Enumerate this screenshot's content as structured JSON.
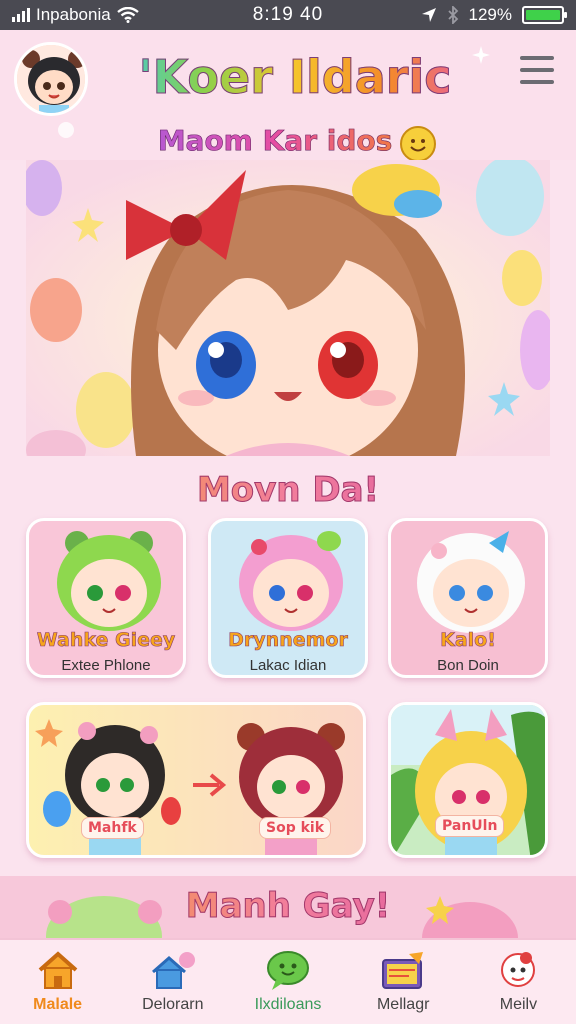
{
  "status_bar": {
    "carrier": "Inpabonia",
    "time": "8:19 40",
    "battery": "129%",
    "battery_level": 1.0
  },
  "header": {
    "title": "'Koer Ildaric",
    "subtitle": "Maom Kar idos"
  },
  "section1": {
    "title": "Movn Da!"
  },
  "cards": [
    {
      "name": "Wahke Gieey",
      "sub": "Extee Phlone"
    },
    {
      "name": "Drynnemor",
      "sub": "Lakac Idian"
    },
    {
      "name": "Kalo!",
      "sub": "Bon Doin"
    },
    {
      "tag_left": "Mahfk",
      "tag_right": "Sop kik"
    },
    {
      "tag": "PanUln"
    }
  ],
  "section2": {
    "title": "Manh Gay!"
  },
  "tabs": [
    {
      "label": "Malale",
      "icon": "home-icon",
      "active": true
    },
    {
      "label": "Delorarn",
      "icon": "house-chat-icon",
      "active": false
    },
    {
      "label": "Ilxdiloans",
      "icon": "chat-bubble-icon",
      "active": false
    },
    {
      "label": "Mellagr",
      "icon": "gift-book-icon",
      "active": false
    },
    {
      "label": "Meilv",
      "icon": "character-icon",
      "active": false
    }
  ],
  "colors": {
    "accent": "#f08a1c",
    "background": "#fbe3ee",
    "status_bar": "#4a4a52"
  }
}
